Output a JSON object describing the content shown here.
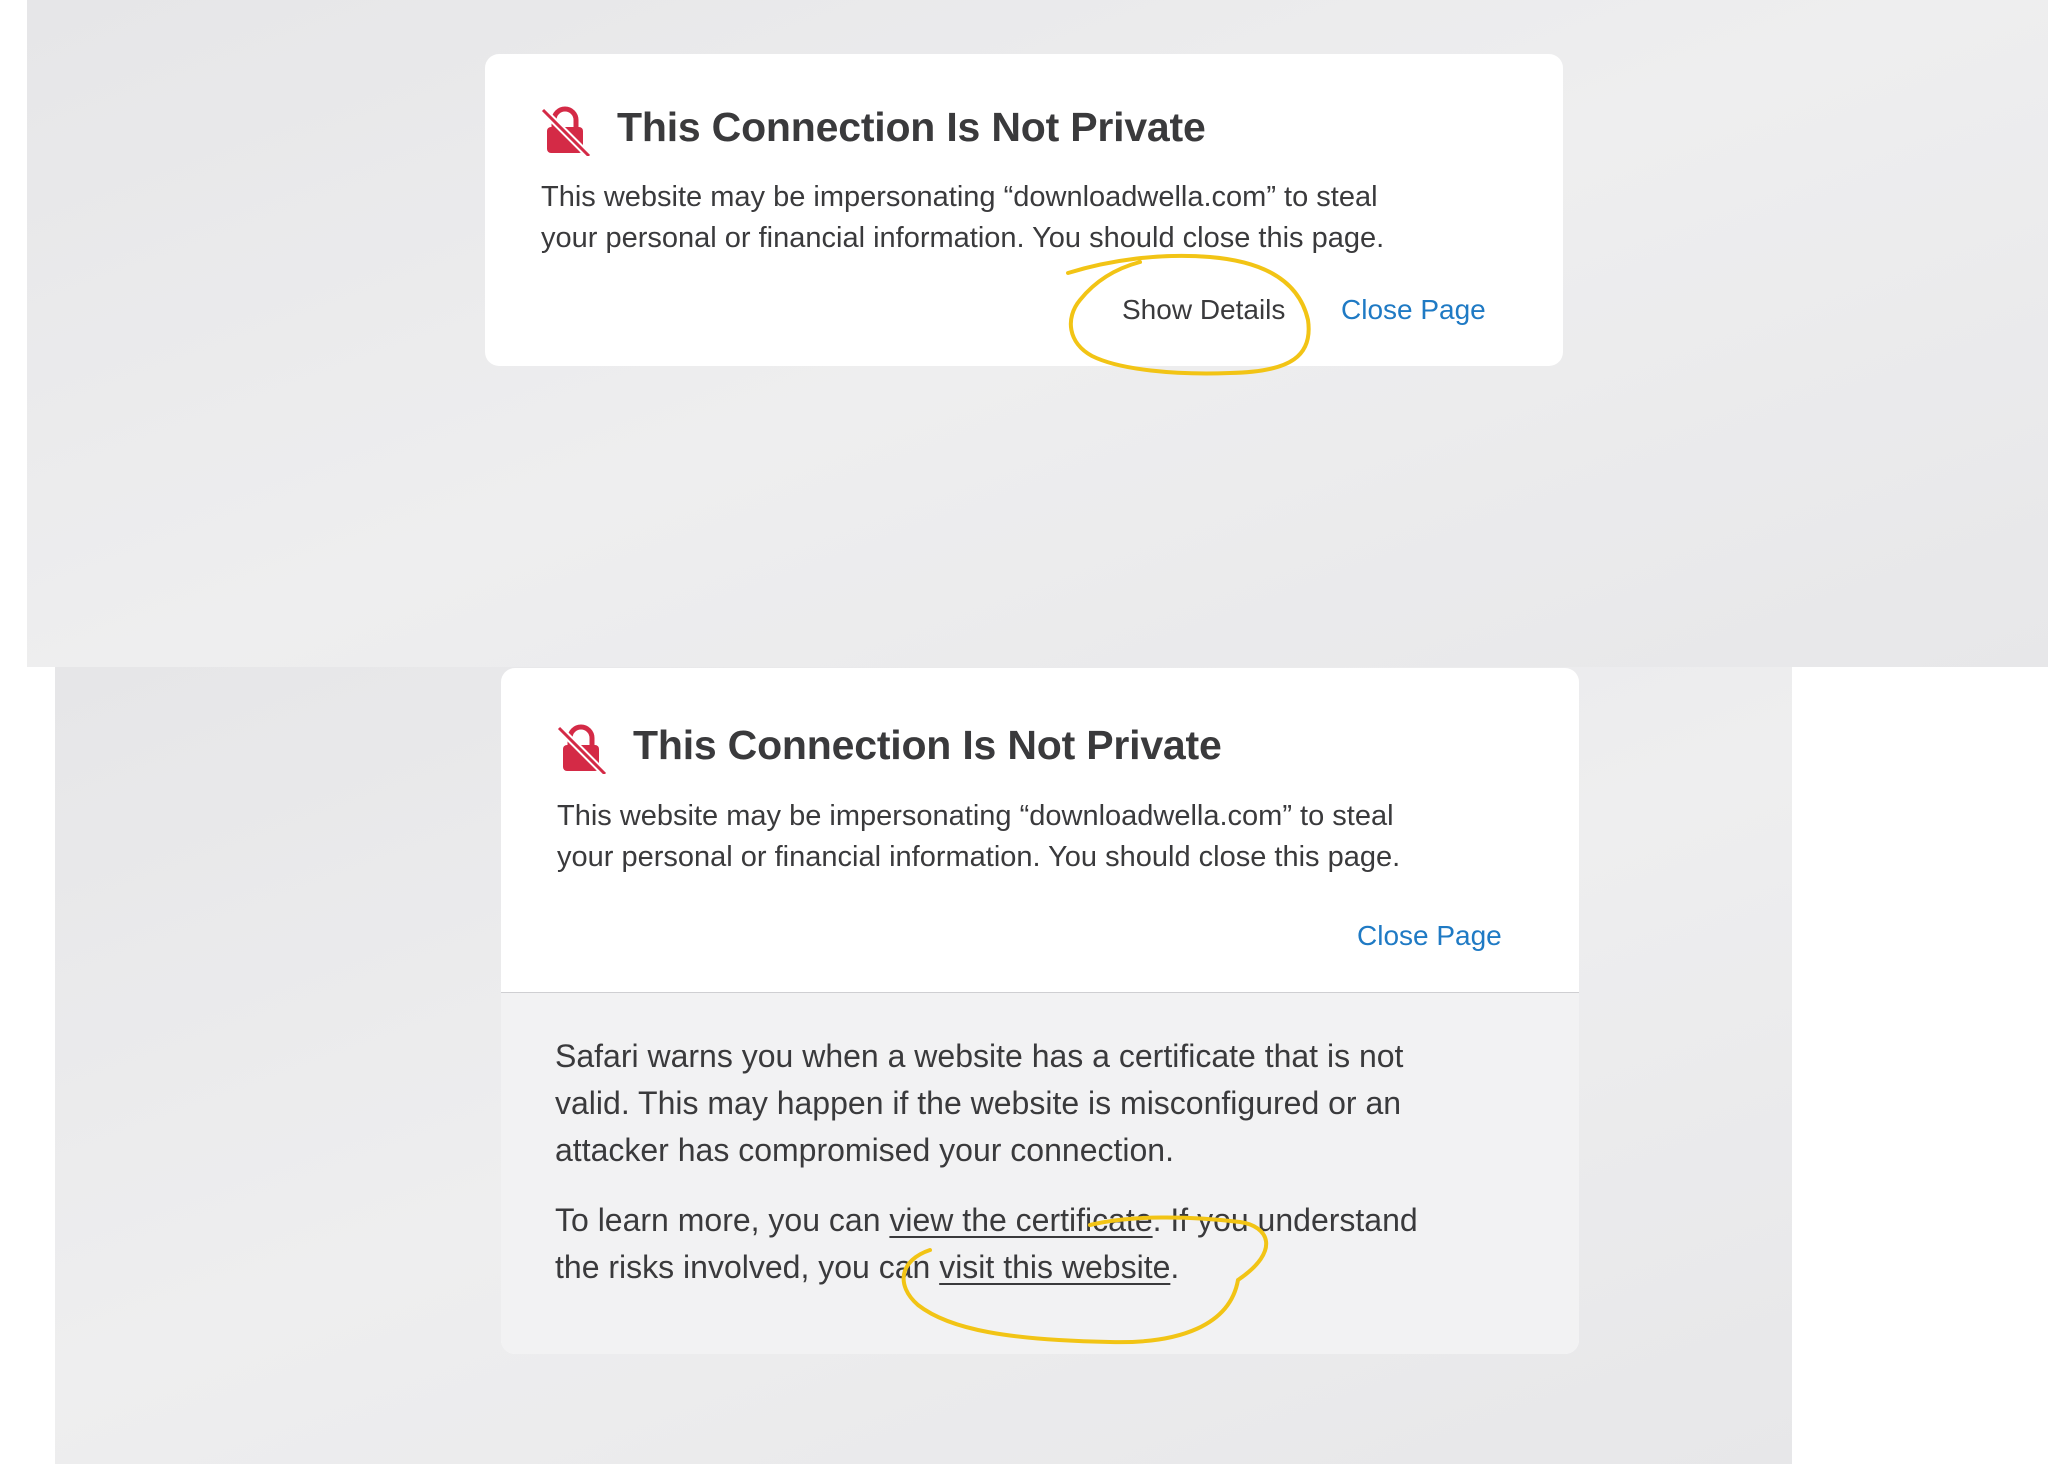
{
  "top_card": {
    "title": "This Connection Is Not Private",
    "message_line1": "This website may be impersonating “downloadwella.com” to steal",
    "message_line2": "your personal or financial information. You should close this page.",
    "show_details_label": "Show Details",
    "close_page_label": "Close Page"
  },
  "bottom_card": {
    "title": "This Connection Is Not Private",
    "message_line1": "This website may be impersonating “downloadwella.com” to steal",
    "message_line2": "your personal or financial information. You should close this page.",
    "close_page_label": "Close Page",
    "details": {
      "paragraph1_line1": "Safari warns you when a website has a certificate that is not",
      "paragraph1_line2": "valid. This may happen if the website is misconfigured or an",
      "paragraph1_line3": "attacker has compromised your connection.",
      "learn_more_prefix": "To learn more, you can ",
      "view_certificate_link": "view the certificate",
      "learn_more_middle": ". If you understand",
      "risks_prefix": "the risks involved, you can ",
      "visit_website_link": "visit this website",
      "risks_suffix": "."
    }
  },
  "colors": {
    "lock_red": "#d42a46",
    "link_blue": "#1f7ac4",
    "annotation_yellow": "#f2c415",
    "text": "#3a3a3c"
  },
  "icons": {
    "warning_lock": "lock-slash-icon"
  }
}
